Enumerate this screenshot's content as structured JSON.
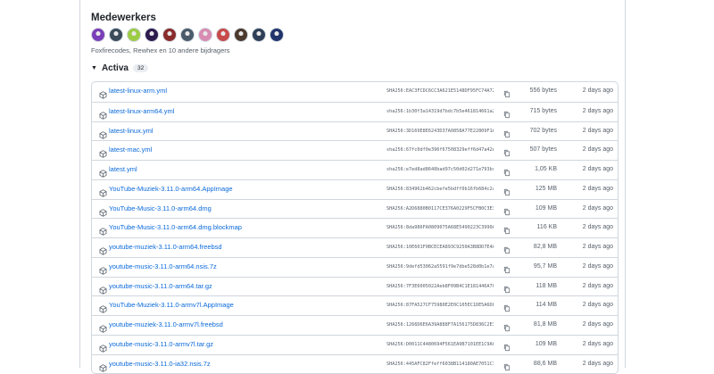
{
  "contributors": {
    "title": "Medewerkers",
    "note": "Foxfirecodes, Rewhex en 10 andere bijdragers",
    "avatar_colors": [
      "#7a3fb8",
      "#3b4b5a",
      "#9ccc44",
      "#2d1b4e",
      "#8a2c2c",
      "#4a5a6a",
      "#d98cb3",
      "#c94a4a",
      "#4c3a2e",
      "#2f3f58",
      "#20336b"
    ]
  },
  "assets": {
    "label": "Activa",
    "count": "32",
    "rows": [
      {
        "name": "latest-linux-arm.yml",
        "sha": "SHA256:EAC3FCDC6CC3A621E5148DF95FC74A72E",
        "size": "556 bytes",
        "date": "2 days ago"
      },
      {
        "name": "latest-linux-arm64.yml",
        "sha": "sha256:1b30f3a14319d7bdc7b5e461814661a2",
        "size": "715 bytes",
        "date": "2 days ago"
      },
      {
        "name": "latest-linux.yml",
        "sha": "SHA256:3D169E8E6243D37A0858A77E22809F1A",
        "size": "702 bytes",
        "date": "2 days ago"
      },
      {
        "name": "latest-mac.yml",
        "sha": "sha256:67fc0df0e396f67508329eff6d47a42e",
        "size": "507 bytes",
        "date": "2 days ago"
      },
      {
        "name": "latest.yml",
        "sha": "sha256:e7ed8ad8648bad97c50d02d271e793bc",
        "size": "1,05 KB",
        "date": "2 days ago"
      },
      {
        "name": "YouTube-Muziek-3.11.0-arm64.AppImage",
        "sha": "SHA256:834962b462cbefe5bdff0b16fb684c2a",
        "size": "125 MB",
        "date": "2 days ago"
      },
      {
        "name": "YouTube-Music-3.11.0-arm64.dmg",
        "sha": "SHA256:A2D6880B0117CE376A0229F5CFB0C3E3",
        "size": "109 MB",
        "date": "2 days ago"
      },
      {
        "name": "YouTube-Music-3.11.0-arm64.dmg.blockmap",
        "sha": "SHA256:8da986FA0809075A68E5490223C3990A",
        "size": "116 KB",
        "date": "2 days ago"
      },
      {
        "name": "youtube-muziek-3.11.0-arm64.freebsd",
        "sha": "SHA256:10E601F0BCECEA893C9250A3B8DD7E4A",
        "size": "82,8 MB",
        "date": "2 days ago"
      },
      {
        "name": "youtube-music-3.11.0-arm64.nsis.7z",
        "sha": "SHA256:9defd53062a5591f9e7dbe528d0b1e7a",
        "size": "95,7 MB",
        "date": "2 days ago"
      },
      {
        "name": "youtube-music-3.11.0-arm64.tar.gz",
        "sha": "SHA256:7F3E6005022Aeb8F09B4C1E181446A7C",
        "size": "118 MB",
        "date": "2 days ago"
      },
      {
        "name": "YouTube-Muziek-3.11.0-armv7l.AppImage",
        "sha": "SHA256:87FA527CF75980E2E0C105EC1DE5A6D8",
        "size": "114 MB",
        "date": "2 days ago"
      },
      {
        "name": "youtube-muziek-3.11.0-armv7l.freebsd",
        "sha": "SHA256:1266D6E6A39A888F7A156175D836C2E3",
        "size": "81,8 MB",
        "date": "2 days ago"
      },
      {
        "name": "youtube-music-3.11.0-armv7l.tar.gz",
        "sha": "SHA256:D0011C4480694F561EA9B7101EE1C9A0",
        "size": "109 MB",
        "date": "2 days ago"
      },
      {
        "name": "youtube-music-3.11.0-ia32.nsis.7z",
        "sha": "SHA256:445AFC82Ffeff6038B114180AE7051C3",
        "size": "88,6 MB",
        "date": "2 days ago"
      }
    ]
  },
  "colors": {
    "link": "#0969da",
    "muted": "#57606a",
    "border": "#d0d7de"
  },
  "icons": {
    "asset": "package-icon",
    "copy": "copy-icon",
    "collapse": "triangle-down-icon"
  }
}
